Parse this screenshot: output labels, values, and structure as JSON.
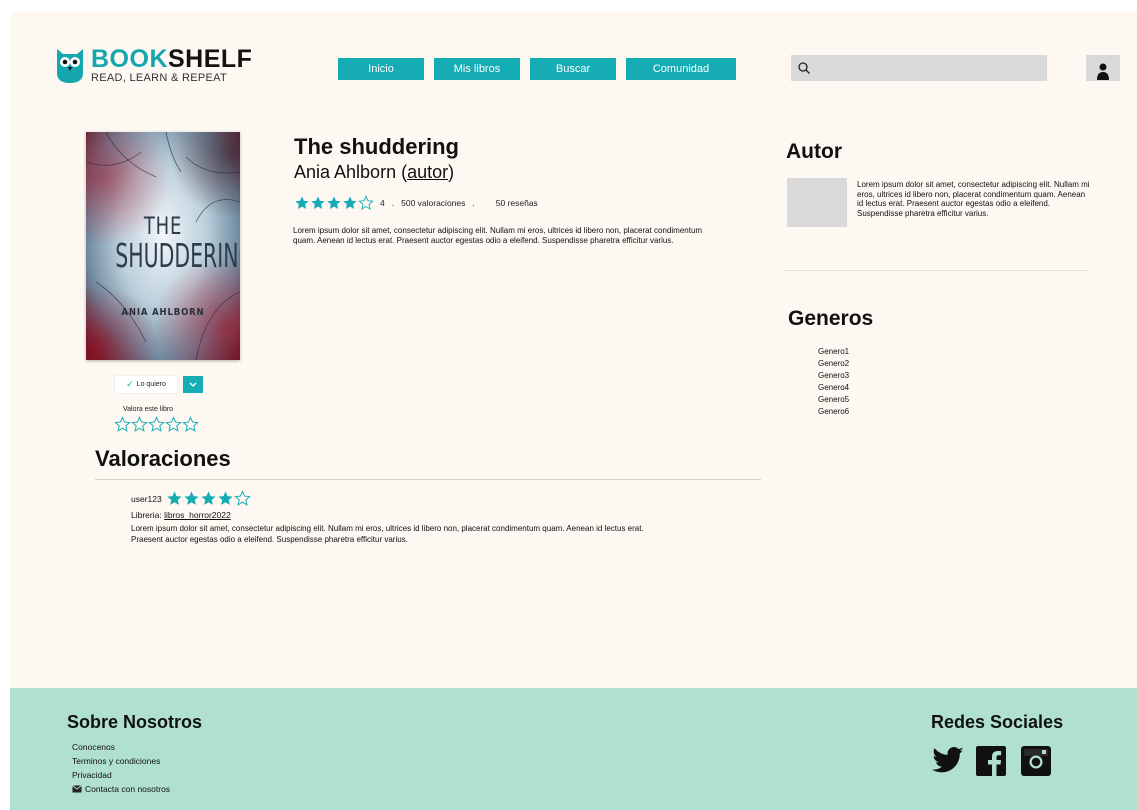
{
  "header": {
    "logo_name_part1": "BOOK",
    "logo_name_part2": "SHELF",
    "logo_tagline": "READ, LEARN & REPEAT",
    "nav": [
      "Inicio",
      "Mis libros",
      "Buscar",
      "Comunidad"
    ],
    "search_placeholder": ""
  },
  "book": {
    "cover_title_line1": "THE",
    "cover_title_line2": "SHUDDERING",
    "cover_author": "ANIA AHLBORN",
    "title": "The shuddering",
    "author_name": "Ania Ahlborn (",
    "author_link": "autor",
    "author_close": ")",
    "rating_value": 4,
    "rating_display": "4",
    "rating_separator": ".",
    "ratings_count": "500 valoraciones",
    "reviews_count": "50 reseñas",
    "description": "Lorem ipsum dolor sit amet, consectetur adipiscing elit. Nullam mi eros, ultrices id libero non, placerat condimentum quam. Aenean id lectus erat. Praesent auctor egestas odio a eleifend. Suspendisse pharetra efficitur varius.",
    "want_label": "Lo quiero",
    "rate_label": "Valora este libro"
  },
  "author_panel": {
    "title": "Autor",
    "text": "Lorem ipsum dolor sit amet, consectetur adipiscing elit. Nullam mi eros, ultrices id libero non, placerat condimentum quam. Aenean id lectus erat. Praesent auctor egestas odio a eleifend. Suspendisse pharetra efficitur varius."
  },
  "genres": {
    "title": "Generos",
    "items": [
      "Genero1",
      "Genero2",
      "Genero3",
      "Genero4",
      "Genero5",
      "Genero6"
    ]
  },
  "reviews": {
    "title": "Valoraciones",
    "items": [
      {
        "user": "user123",
        "rating": 4,
        "library_label": "Libreria: ",
        "library_link": "libros_horror2022",
        "text": "Lorem ipsum dolor sit amet, consectetur adipiscing elit. Nullam mi eros, ultrices id libero non, placerat condimentum quam. Aenean id lectus erat. Praesent auctor egestas odio a eleifend. Suspendisse pharetra efficitur varius."
      }
    ]
  },
  "footer": {
    "about_title": "Sobre Nosotros",
    "links": [
      "Conocenos",
      "Terminos y condiciones",
      "Privacidad",
      "Contacta con nosotros"
    ],
    "social_title": "Redes Sociales",
    "social_icons": [
      "twitter-icon",
      "facebook-icon",
      "instagram-icon"
    ]
  },
  "colors": {
    "accent": "#16acb4",
    "page_bg": "#fdf8f2",
    "footer_bg": "#b0e0d2",
    "gray": "#d9d9d9"
  }
}
